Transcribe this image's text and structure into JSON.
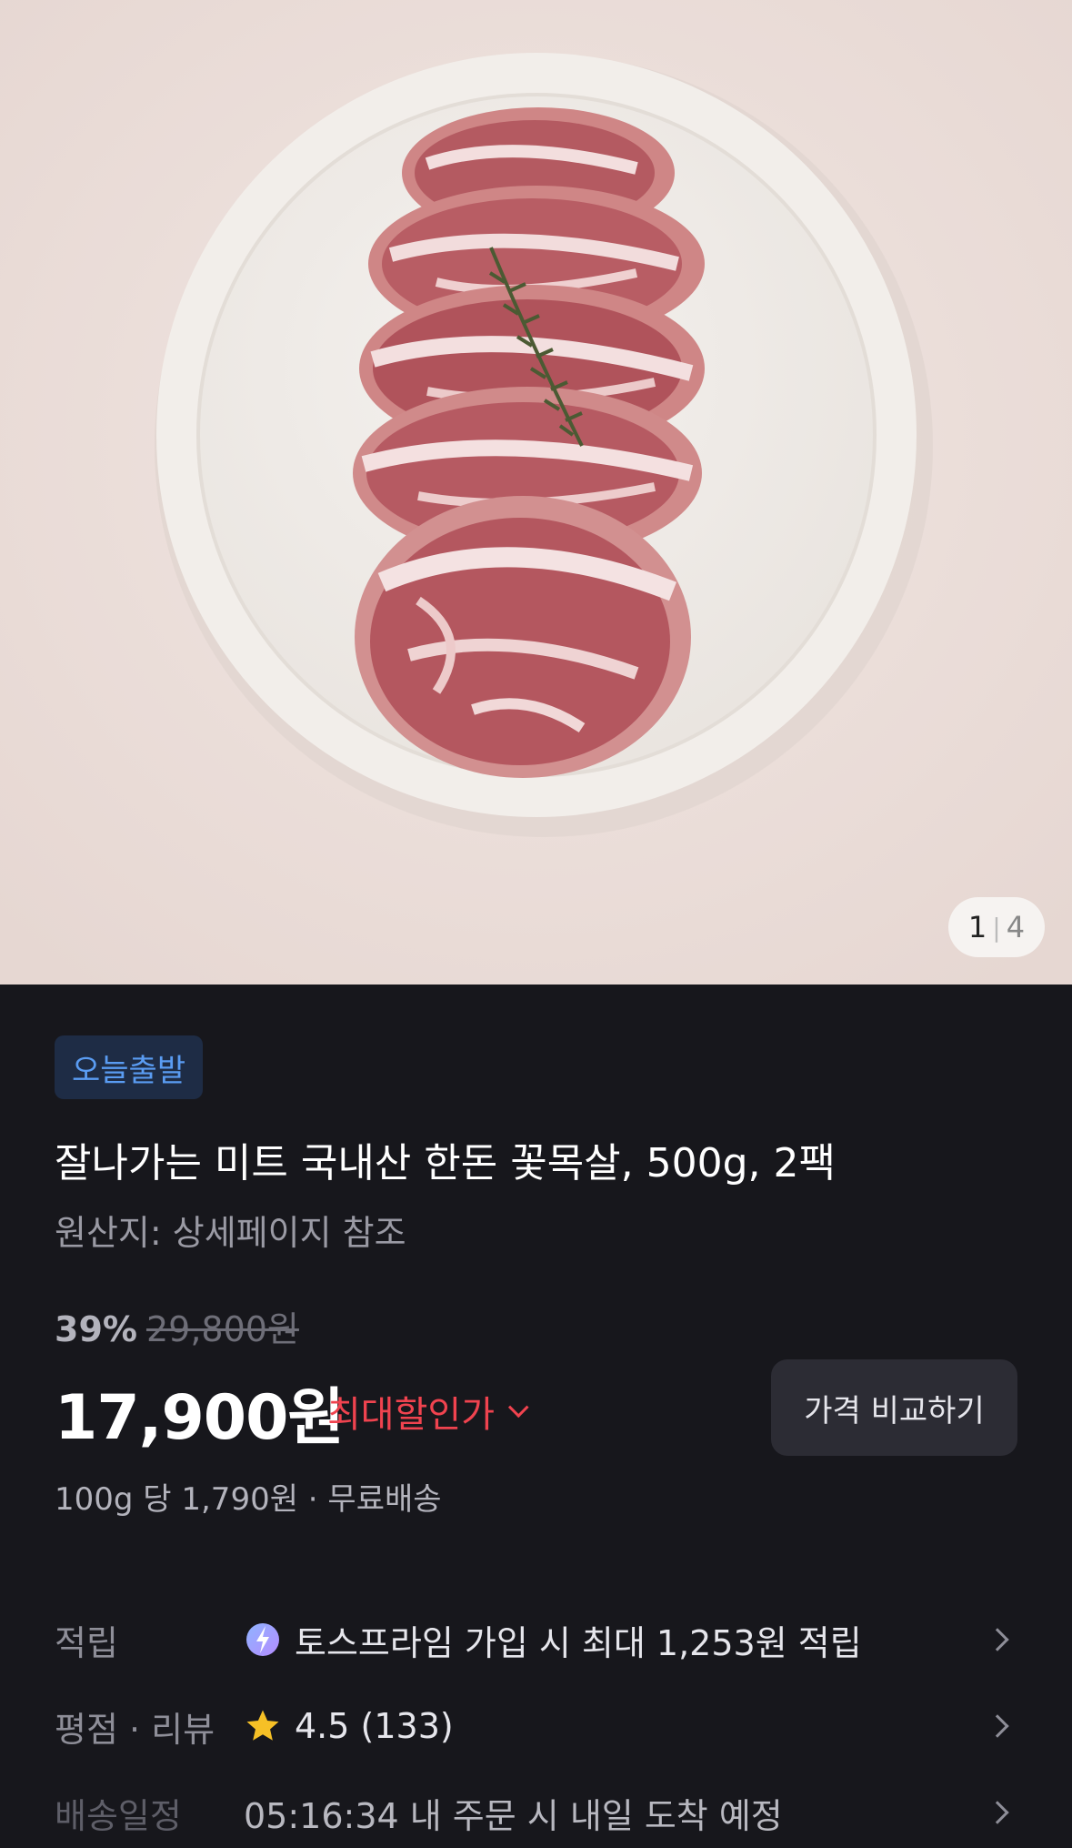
{
  "gallery": {
    "current": "1",
    "separator": "|",
    "total": "4"
  },
  "product": {
    "badge": "오늘출발",
    "title": "잘나가는 미트 국내산 한돈 꽃목살, 500g, 2팩",
    "origin": "원산지: 상세페이지 참조",
    "discount_percent": "39%",
    "original_price": "29,800원",
    "price": "17,900원",
    "max_discount_label": "최대할인가",
    "compare_button": "가격 비교하기",
    "unit_price": "100g 당 1,790원 · 무료배송"
  },
  "details": {
    "points": {
      "label": "적립",
      "value": "토스프라임 가입 시 최대 1,253원 적립"
    },
    "rating": {
      "label": "평점 · 리뷰",
      "value": "4.5 (133)"
    },
    "delivery": {
      "label": "배송일정",
      "value": "05:16:34 내 주문 시 내일 도착 예정"
    }
  },
  "colors": {
    "accent_red": "#f0434f",
    "badge_blue": "#5a9cf2",
    "background": "#17171c",
    "star": "#f6c026"
  }
}
